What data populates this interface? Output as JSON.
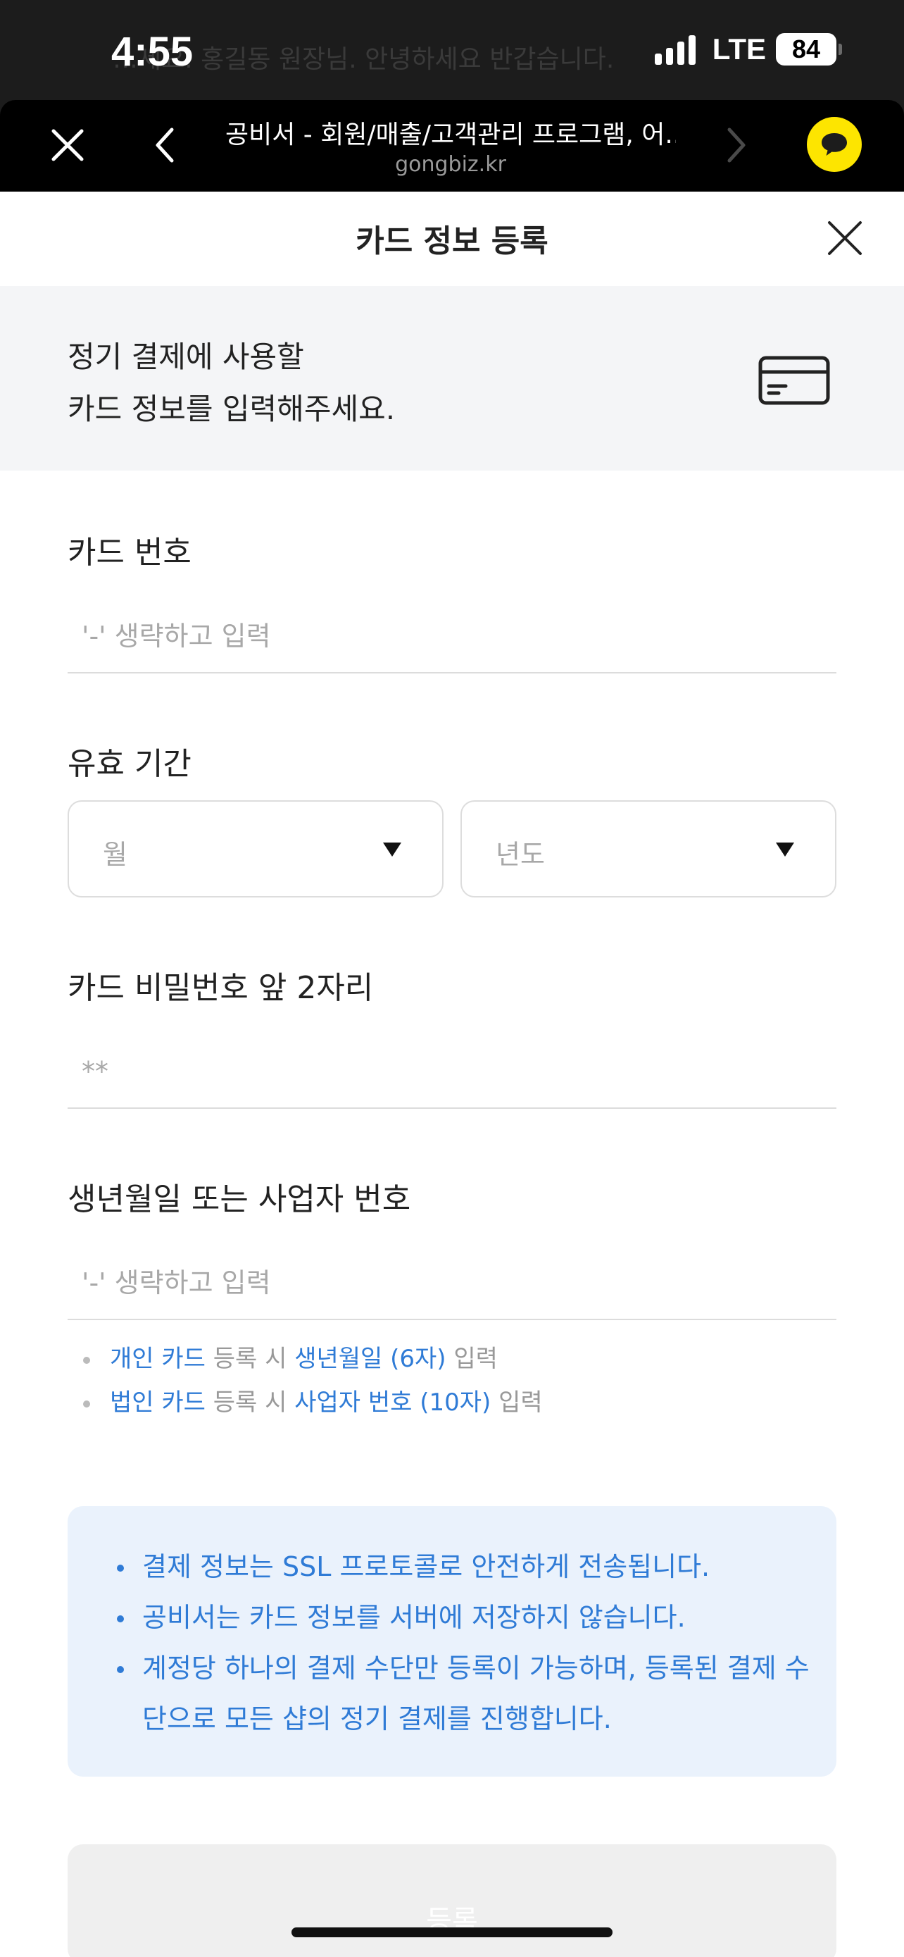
{
  "status_bar": {
    "time": "4:55",
    "network": "LTE",
    "battery": "84"
  },
  "background_page": {
    "text": "…세요. 홍길동 원장님. 안녕하세요 반갑습니다."
  },
  "browser": {
    "title": "공비서 - 회원/매출/고객관리 프로그램, 어...",
    "url": "gongbiz.kr",
    "icons": [
      "close-icon",
      "back-icon",
      "forward-icon",
      "kakao-chat-icon"
    ]
  },
  "modal": {
    "title": "카드 정보 등록",
    "intro_line1": "정기 결제에 사용할",
    "intro_line2": "카드 정보를 입력해주세요."
  },
  "form": {
    "card_number": {
      "label": "카드 번호",
      "placeholder": "'-' 생략하고 입력",
      "value": ""
    },
    "expiry": {
      "label": "유효 기간",
      "month_placeholder": "월",
      "year_placeholder": "년도"
    },
    "password": {
      "label": "카드 비밀번호 앞 2자리",
      "placeholder": "**",
      "value": ""
    },
    "birth_or_business": {
      "label": "생년월일 또는 사업자 번호",
      "placeholder": "'-' 생략하고 입력",
      "value": ""
    },
    "hints": [
      {
        "a": "개인 카드",
        "b": " 등록 시 ",
        "c": "생년월일 (6자)",
        "d": " 입력"
      },
      {
        "a": "법인 카드",
        "b": " 등록 시 ",
        "c": "사업자 번호 (10자)",
        "d": " 입력"
      }
    ]
  },
  "notice": {
    "items": [
      "결제 정보는 SSL 프로토콜로 안전하게 전송됩니다.",
      "공비서는 카드 정보를 서버에 저장하지 않습니다.",
      "계정당 하나의 결제 수단만 등록이 가능하며, 등록된 결제 수단으로 모든 샵의 정기 결제를 진행합니다."
    ]
  },
  "submit": {
    "label": "등록"
  },
  "colors": {
    "accent_blue": "#2f7bd6",
    "notice_bg": "#eaf2fc",
    "kakao_yellow": "#fde500",
    "disabled_button": "#efefef"
  }
}
